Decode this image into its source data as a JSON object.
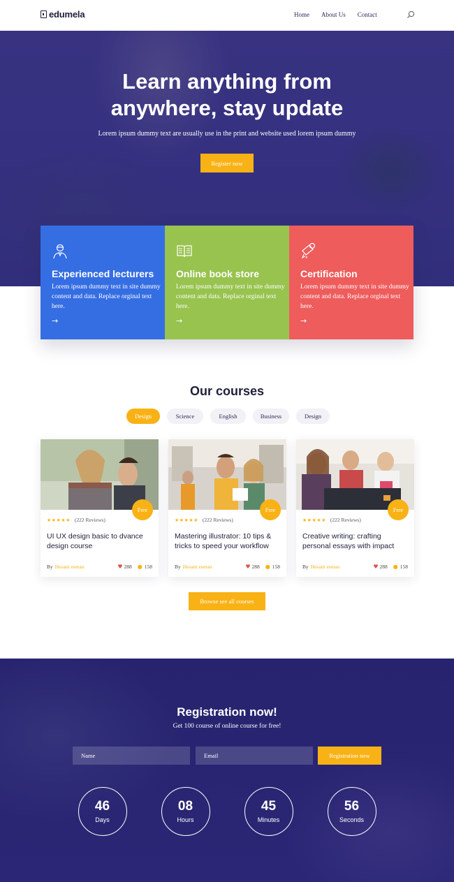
{
  "brand": {
    "name": "edumela"
  },
  "nav": {
    "links": [
      "Home",
      "About Us",
      "Contact"
    ],
    "search_icon": "search-icon"
  },
  "hero": {
    "title_line1": "Learn anything from",
    "title_line2": "anywhere, stay update",
    "subtitle": "Lorem ipsum dummy text are usually use in the print and website used lorem ipsum dummy",
    "button": "Register now"
  },
  "features": [
    {
      "title": "Experienced lecturers",
      "text": "Lorem ipsum dummy text in site dummy content and data. Replace orginal text here.",
      "icon": "lecturer-icon",
      "color": "#356ee3"
    },
    {
      "title": "Online book store",
      "text": "Lorem ipsum dummy text in site dummy content and data. Replace orginal text here.",
      "icon": "book-icon",
      "color": "#98c34f"
    },
    {
      "title": "Certification",
      "text": "Lorem ipsum dummy text in site dummy content and data. Replace orginal text here.",
      "icon": "certificate-icon",
      "color": "#ee5c5c"
    }
  ],
  "courses": {
    "title": "Our courses",
    "filters": [
      "Design",
      "Science",
      "English",
      "Business",
      "Design"
    ],
    "active_filter": "Design",
    "items": [
      {
        "title": "UI UX design basic to dvance design course",
        "badge": "Free",
        "rating": 4.5,
        "reviews": "(222 Reviews)",
        "by": "By",
        "author": "Hesam esman",
        "likes": "288",
        "students": "158"
      },
      {
        "title": "Mastering illustrator: 10 tips & tricks to speed your workflow",
        "badge": "Free",
        "rating": 4.5,
        "reviews": "(222 Reviews)",
        "by": "By",
        "author": "Hesam esman",
        "likes": "288",
        "students": "158"
      },
      {
        "title": "Creative writing: crafting personal essays with impact",
        "badge": "Free",
        "rating": 4.5,
        "reviews": "(222 Reviews)",
        "by": "By",
        "author": "Hesam esman",
        "likes": "288",
        "students": "158"
      }
    ],
    "browse_button": "Browse see all courses"
  },
  "registration": {
    "title": "Registration now!",
    "subtitle": "Get 100 course of online course for free!",
    "name_placeholder": "Name",
    "email_placeholder": "Email",
    "button": "Registration now",
    "countdown": [
      {
        "value": "46",
        "label": "Days"
      },
      {
        "value": "08",
        "label": "Hours"
      },
      {
        "value": "45",
        "label": "Minutes"
      },
      {
        "value": "56",
        "label": "Seconds"
      }
    ]
  },
  "colors": {
    "accent": "#f9b215",
    "navy": "#27236e",
    "hero": "#3b3784"
  }
}
